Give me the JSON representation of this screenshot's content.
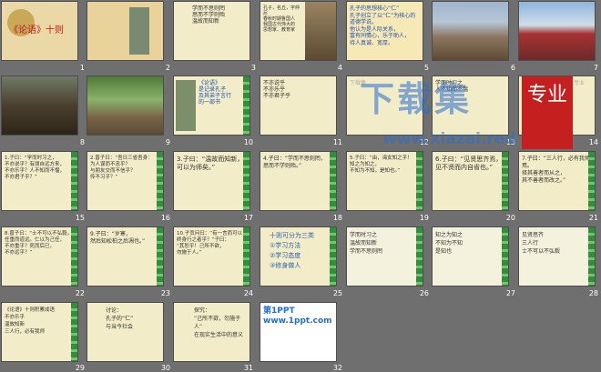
{
  "slides": [
    {
      "n": "1",
      "text": "《论语》十则"
    },
    {
      "n": "2",
      "text": ""
    },
    {
      "n": "3",
      "text": "学而不思则罔\n思而不学则殆\n温故而知新"
    },
    {
      "n": "4",
      "text": "孔子，名丘，字仲尼\n春秋时期鲁国人\n我国古代伟大的\n思想家、教育家"
    },
    {
      "n": "5",
      "text": "孔子的思想核心“仁”\n孔子创立了以“仁”为核心的道德学说。\n他认为是人际关系，\n富有同情心，乐于助人，\n待人真诚、宽厚。"
    },
    {
      "n": "6",
      "text": ""
    },
    {
      "n": "7",
      "text": ""
    },
    {
      "n": "8",
      "text": ""
    },
    {
      "n": "9",
      "text": ""
    },
    {
      "n": "10",
      "text": "《论语》\n是记录孔子\n及其弟子言行\n的一部书"
    },
    {
      "n": "11",
      "text": "不亦说乎\n不亦乐乎\n不亦君子乎"
    },
    {
      "n": "12",
      "text": "下载集"
    },
    {
      "n": "13",
      "text": "学而时习之\n人不知而不愠"
    },
    {
      "n": "14",
      "text": "专业"
    },
    {
      "n": "15",
      "text": "1.子曰：“学而时习之，\n不亦说乎？有朋自远方来，\n不亦乐乎？人不知而不愠，\n不亦君子乎？”"
    },
    {
      "n": "16",
      "text": "2.曾子曰：“吾日三省吾身：\n为人谋而不忠乎？\n与朋友交而不信乎？\n传不习乎？”"
    },
    {
      "n": "17",
      "text": "3.子曰：“温故而知新，\n可以为师矣。”"
    },
    {
      "n": "18",
      "text": "4.子曰：“学而不思则罔，\n思而不学则殆。”"
    },
    {
      "n": "19",
      "text": "5.子曰：“由，诲女知之乎！\n知之为知之，\n不知为不知，是知也。”"
    },
    {
      "n": "20",
      "text": "6.子曰：“见贤思齐焉，\n见不贤而内自省也。”"
    },
    {
      "n": "21",
      "text": "7.子曰：“三人行，必有我师焉。\n择其善者而从之，\n其不善者而改之。”"
    },
    {
      "n": "22",
      "text": "8.曾子曰：“士不可以不弘毅，\n任重而道远。仁以为己任，\n不亦重乎？死而后已，\n不亦远乎？”"
    },
    {
      "n": "23",
      "text": "9.子曰：“岁寒，\n然后知松柏之后凋也。”"
    },
    {
      "n": "24",
      "text": "10.子贡问曰：“有一言而可以\n终身行之者乎？”子曰：\n“其恕乎！己所不欲，\n勿施于人。”"
    },
    {
      "n": "25",
      "text": "十则可分为三类\n①学习方法\n②学习态度\n③修身做人"
    },
    {
      "n": "26",
      "text": "学而时习之\n温故而知新\n学而不思则罔"
    },
    {
      "n": "27",
      "text": "知之为知之\n不知为不知\n是知也"
    },
    {
      "n": "28",
      "text": "见贤思齐\n三人行\n士不可以不弘毅"
    },
    {
      "n": "29",
      "text": "《论语》十则积累成语\n不亦乐乎\n温故知新\n三人行，必有我师"
    },
    {
      "n": "30",
      "text": "讨论：\n孔子的“仁”\n与当今社会"
    },
    {
      "n": "31",
      "text": "探究：\n“己所不欲，勿施于人”\n在现实生活中的意义"
    },
    {
      "n": "32",
      "text": "第1PPT\nwww.1ppt.com"
    }
  ],
  "watermark": {
    "title": "下载集",
    "url": "www.xiazai.red",
    "tag": "专业"
  }
}
